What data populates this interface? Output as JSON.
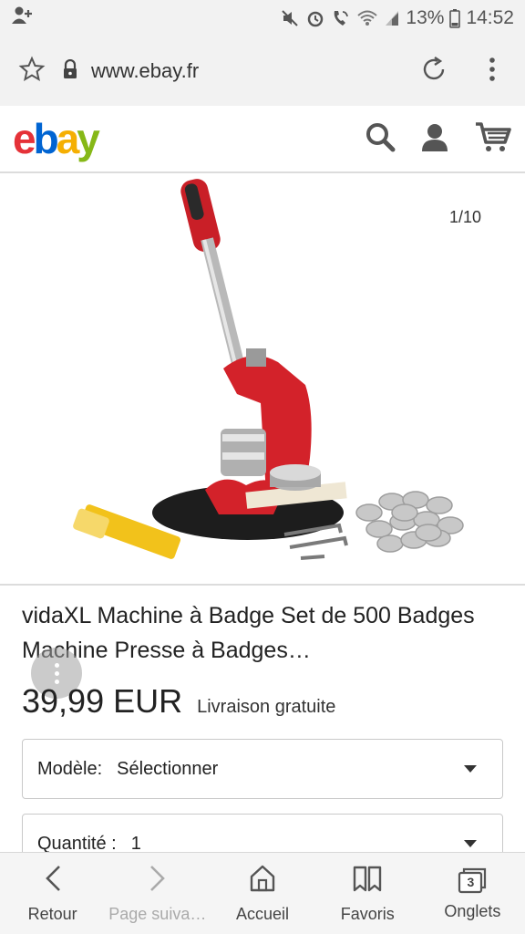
{
  "status_bar": {
    "battery": "13%",
    "time": "14:52",
    "icons": [
      "add-contact-icon",
      "mute-icon",
      "alarm-icon",
      "wifi-call-icon",
      "wifi-icon",
      "signal-icon",
      "battery-icon"
    ]
  },
  "browser": {
    "url": "www.ebay.fr",
    "icons": [
      "star-icon",
      "lock-icon",
      "reload-icon",
      "more-icon"
    ]
  },
  "header": {
    "logo": {
      "e": "e",
      "b": "b",
      "a": "a",
      "y": "y"
    },
    "logo_colors": {
      "e": "#e53238",
      "b": "#0064d2",
      "a": "#f5af02",
      "y": "#86b817"
    },
    "icons": [
      "search-icon",
      "user-icon",
      "cart-icon"
    ]
  },
  "product": {
    "image_counter": "1/10",
    "title": "vidaXL Machine à Badge Set de 500 Badges Machine Presse à Badges…",
    "price": "39,99 EUR",
    "shipping": "Livraison gratuite"
  },
  "options": {
    "model": {
      "label": "Modèle:",
      "value": "Sélectionner"
    },
    "quantity": {
      "label": "Quantité :",
      "value": "1"
    }
  },
  "bottom_nav": [
    {
      "label": "Retour",
      "icon": "back-icon"
    },
    {
      "label": "Page suiva…",
      "icon": "forward-icon"
    },
    {
      "label": "Accueil",
      "icon": "home-icon"
    },
    {
      "label": "Favoris",
      "icon": "bookmarks-icon"
    },
    {
      "label": "Onglets",
      "icon": "tabs-icon",
      "count": "3"
    }
  ]
}
